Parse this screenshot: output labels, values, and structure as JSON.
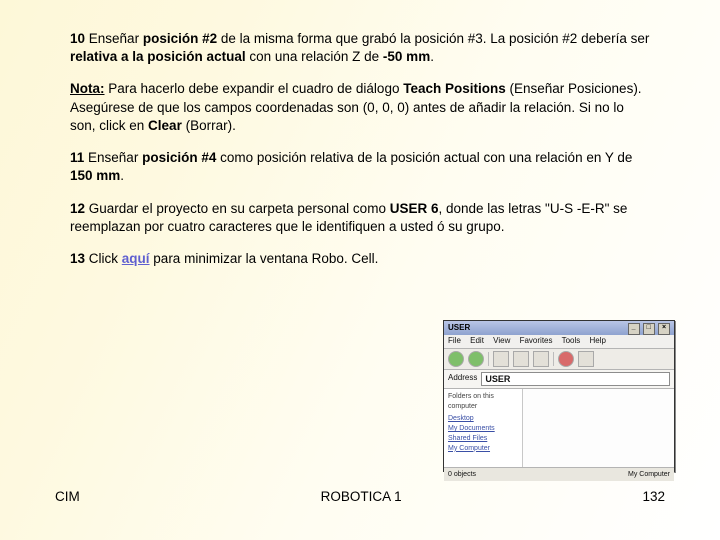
{
  "steps": {
    "s10": {
      "num": "10",
      "t1": " Enseñar ",
      "b1": "posición #2",
      "t2": " de la misma forma que grabó la posición #3. La posición #2 debería ser ",
      "b2": "relativa a la posición actual",
      "t3": " con una relación Z de ",
      "b3": "-50 mm",
      "t4": "."
    },
    "note": {
      "lead": "Nota:",
      "t1": " Para hacerlo debe expandir el cuadro de diálogo ",
      "b1": "Teach Positions",
      "t2": " (Enseñar Posiciones). Asegúrese de que los campos coordenadas son (0, 0, 0) antes de añadir la relación. Si no lo son, click en ",
      "b2": "Clear",
      "t3": " (Borrar)."
    },
    "s11": {
      "num": "11",
      "t1": " Enseñar ",
      "b1": "posición #4",
      "t2": " como posición relativa de la posición actual con una relación en Y de ",
      "b2": "150 mm",
      "t3": "."
    },
    "s12": {
      "num": "12",
      "t1": " Guardar el proyecto en su carpeta personal como ",
      "b1": "USER 6",
      "t2": ", donde las letras \"U-S -E-R\" se reemplazan por cuatro caracteres que le identifiquen a usted ó su grupo."
    },
    "s13": {
      "num": "13",
      "t1": " Click ",
      "link": "aquí",
      "t2": " para minimizar la ventana Robo. Cell."
    }
  },
  "embed": {
    "title": "USER",
    "menu": [
      "File",
      "Edit",
      "View",
      "Favorites",
      "Tools",
      "Help"
    ],
    "addr_label": "Address",
    "addr_value": "USER",
    "side_header": "Folders on this computer",
    "side_links": [
      "Desktop",
      "My Documents",
      "Shared Files",
      "My Computer"
    ],
    "status_left": "0 objects",
    "status_right": "My Computer"
  },
  "footer": {
    "left": "CIM",
    "center": "ROBOTICA 1",
    "right": "132"
  }
}
